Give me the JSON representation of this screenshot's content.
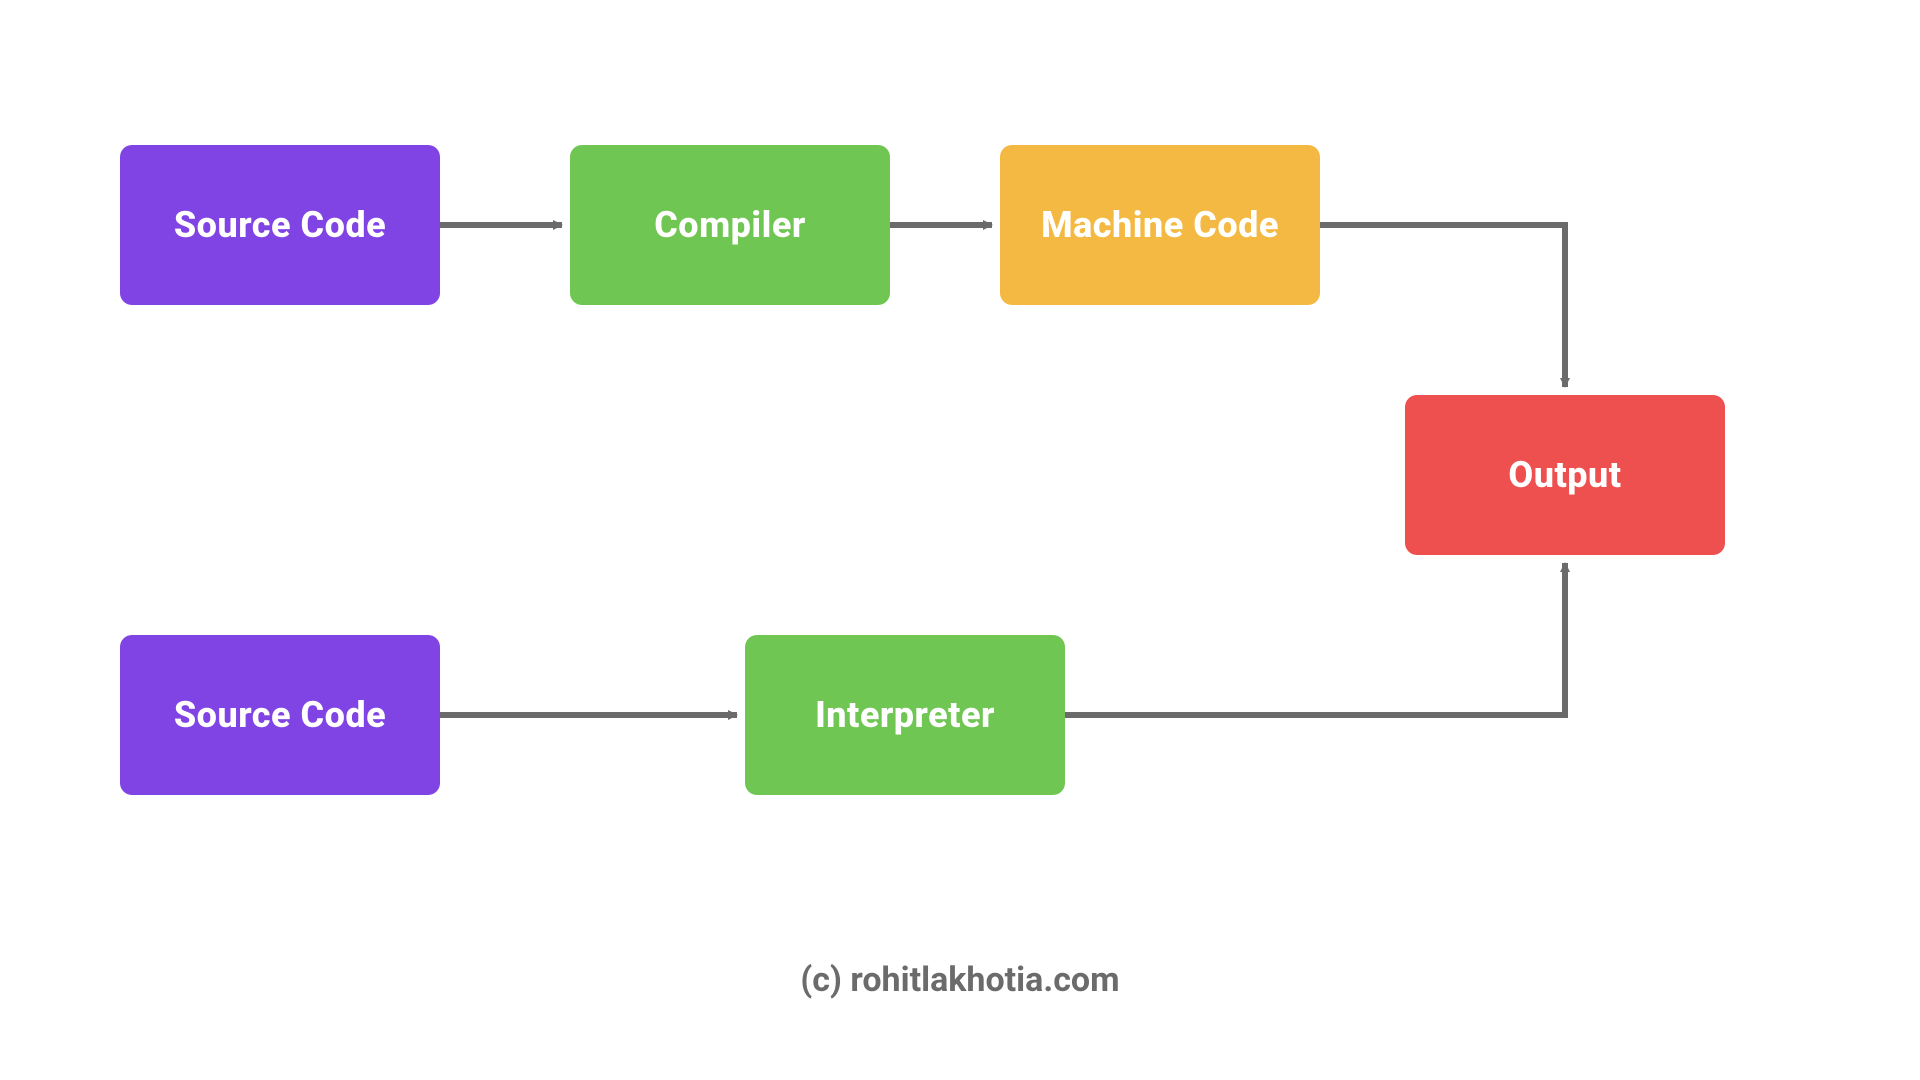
{
  "boxes": {
    "source_code_1": {
      "label": "Source Code",
      "color": "#8043e4"
    },
    "compiler": {
      "label": "Compiler",
      "color": "#6fc653"
    },
    "machine_code": {
      "label": "Machine Code",
      "color": "#f4b942"
    },
    "output": {
      "label": "Output",
      "color": "#ee4f4f"
    },
    "source_code_2": {
      "label": "Source Code",
      "color": "#8043e4"
    },
    "interpreter": {
      "label": "Interpreter",
      "color": "#6fc653"
    }
  },
  "credit": "(c) rohitlakhotia.com",
  "arrow_color": "#6b6b6b"
}
